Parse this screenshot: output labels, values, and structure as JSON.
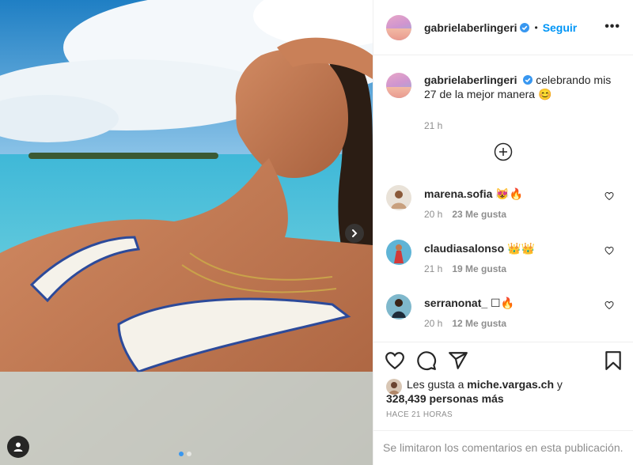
{
  "post": {
    "author": "gabrielaberlingeri",
    "header_sep": "•",
    "follow_label": "Seguir",
    "more_label": "•••",
    "caption_text": "celebrando mis 27 de la mejor manera 😊",
    "caption_time": "21 h"
  },
  "comments": [
    {
      "user": "marena.sofia",
      "text": "😻🔥",
      "time": "20 h",
      "likes": "23 Me gusta"
    },
    {
      "user": "claudiasalonso",
      "text": "👑👑",
      "time": "21 h",
      "likes": "19 Me gusta"
    },
    {
      "user": "serranonat_",
      "text": "☐🔥",
      "time": "20 h",
      "likes": "12 Me gusta"
    }
  ],
  "likes": {
    "prefix": "Les gusta a",
    "user": "miche.vargas.ch",
    "connector": "y",
    "count": "328,439 personas más"
  },
  "timestamp": "HACE 21 HORAS",
  "comments_limited": "Se limitaron los comentarios en esta publicación.",
  "carousel": {
    "total": 2,
    "active": 1
  },
  "colors": {
    "accent": "#0095f6",
    "verified": "#3897f0",
    "muted": "#8e8e8e",
    "border": "#efefef"
  },
  "icons": [
    "chevron-right-icon",
    "user-tag-icon",
    "verified-icon",
    "plus-circle-icon",
    "heart-icon",
    "comment-icon",
    "share-icon",
    "bookmark-icon"
  ]
}
